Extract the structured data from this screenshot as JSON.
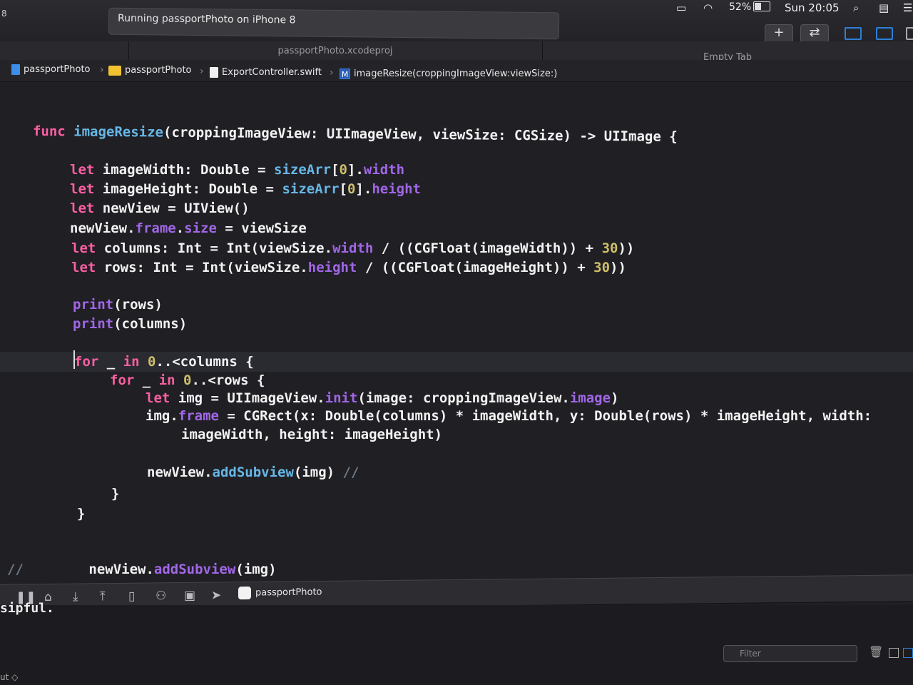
{
  "toolbar": {
    "run_indicator": "8",
    "activity_status": "Running passportPhoto on iPhone 8",
    "add_label": "+",
    "swap_label": "⇄"
  },
  "menu_extras": {
    "battery": "52%",
    "clock": "Sun 20:05"
  },
  "tabs": [
    {
      "label": "passportPhoto.xcodeproj"
    },
    {
      "label": "Empty Tab"
    }
  ],
  "jumpbar": {
    "crumbs": [
      {
        "label": "passportPhoto",
        "icon": "project-file-icon"
      },
      {
        "label": "passportPhoto",
        "icon": "folder-icon"
      },
      {
        "label": "ExportController.swift",
        "icon": "swift-file-icon"
      },
      {
        "label": "imageResize(croppingImageView:viewSize:)",
        "icon": "method-icon",
        "badge": "M"
      }
    ]
  },
  "code": {
    "lines": [
      "func imageResize(croppingImageView: UIImageView, viewSize: CGSize) -> UIImage {",
      "let imageWidth: Double = sizeArr[0].width",
      "let imageHeight: Double = sizeArr[0].height",
      "let newView = UIView()",
      "newView.frame.size = viewSize",
      "let columns: Int = Int(viewSize.width / ((CGFloat(imageWidth)) + 30))",
      "let rows: Int = Int(viewSize.height / ((CGFloat(imageHeight)) + 30))",
      "print(rows)",
      "print(columns)",
      "for _ in 0..<columns {",
      "for _ in 0..<rows {",
      "let img = UIImageView.init(image: croppingImageView.image)",
      "img.frame = CGRect(x: Double(columns) * imageWidth, y: Double(rows) * imageHeight, width:",
      "imageWidth, height: imageHeight)",
      "newView.addSubview(img) //",
      "}",
      "}",
      "//        newView.addSubview(img)"
    ]
  },
  "debugbar": {
    "target_label": "passportPhoto"
  },
  "console": {
    "partial_output": "sipful.",
    "auto_label": "ut ◇",
    "filter_placeholder": "Filter"
  }
}
